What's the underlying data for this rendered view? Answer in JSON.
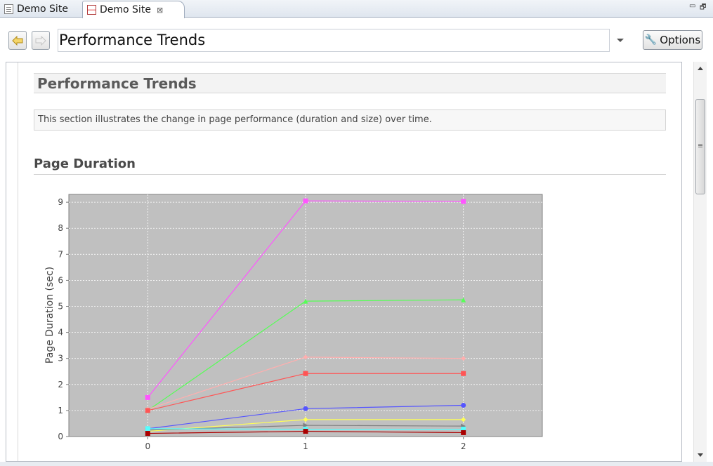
{
  "tabs": [
    {
      "label": "Demo Site",
      "active": false
    },
    {
      "label": "Demo Site",
      "active": true
    }
  ],
  "tab_close_glyph": "⊠",
  "window_controls": {
    "minimize": "▭",
    "restore": "🗗"
  },
  "toolbar": {
    "back_icon": "back-arrow-icon",
    "forward_icon": "forward-arrow-icon",
    "address_value": "Performance Trends",
    "options_label": "Options",
    "options_icon": "wrench-icon"
  },
  "page": {
    "title": "Performance Trends",
    "description": "This section illustrates the change in page performance (duration and size) over time.",
    "subsection_title": "Page Duration"
  },
  "chart_data": {
    "type": "line",
    "title": "",
    "xlabel": "",
    "ylabel": "Page Duration (sec)",
    "x": [
      0,
      1,
      2
    ],
    "xlim": [
      -0.5,
      2.5
    ],
    "ylim": [
      0,
      9.3
    ],
    "yticks": [
      0,
      1,
      2,
      3,
      4,
      5,
      6,
      7,
      8,
      9
    ],
    "grid": true,
    "background": "#c0c0c0",
    "series": [
      {
        "color": "#ff55ff",
        "marker": "square",
        "values": [
          1.5,
          9.05,
          9.03
        ]
      },
      {
        "color": "#55ff55",
        "marker": "triangle",
        "values": [
          1.0,
          5.2,
          5.25
        ]
      },
      {
        "color": "#ffafaf",
        "marker": "diamond",
        "values": [
          1.05,
          3.05,
          3.0
        ]
      },
      {
        "color": "#ff5555",
        "marker": "square",
        "values": [
          1.0,
          2.42,
          2.42
        ]
      },
      {
        "color": "#5555ff",
        "marker": "circle",
        "values": [
          0.3,
          1.07,
          1.2
        ]
      },
      {
        "color": "#ffff55",
        "marker": "diamond",
        "values": [
          0.2,
          0.65,
          0.65
        ]
      },
      {
        "color": "#808080",
        "marker": "triangle-right",
        "values": [
          0.25,
          0.43,
          0.4
        ]
      },
      {
        "color": "#55ffff",
        "marker": "square",
        "values": [
          0.3,
          0.28,
          0.28
        ]
      },
      {
        "color": "#aa0000",
        "marker": "square",
        "values": [
          0.12,
          0.2,
          0.15
        ]
      }
    ]
  }
}
